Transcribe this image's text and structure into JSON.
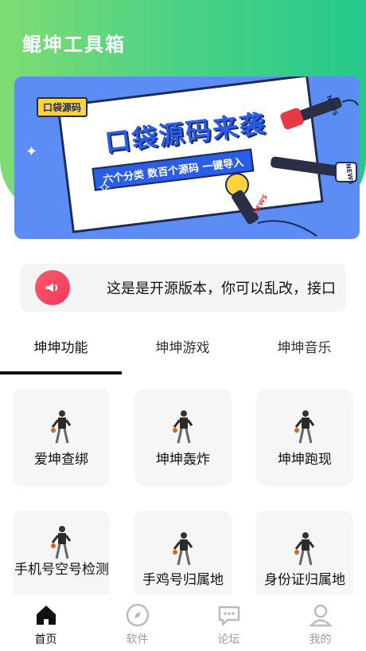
{
  "app": {
    "title": "鲲坤工具箱"
  },
  "banner": {
    "badge": "口袋源码",
    "headline": "口袋源码来袭",
    "subline": "六个分类 数百个源码 一键导入",
    "mic_label": "NEWS"
  },
  "notice": {
    "text": "这是是开源版本，你可以乱改，接口"
  },
  "tabs": [
    {
      "label": "坤坤功能",
      "active": true
    },
    {
      "label": "坤坤游戏",
      "active": false
    },
    {
      "label": "坤坤音乐",
      "active": false
    }
  ],
  "grid": [
    {
      "label": "爱坤查绑"
    },
    {
      "label": "坤坤轰炸"
    },
    {
      "label": "坤坤跑现"
    },
    {
      "label": "手机号空号检测"
    },
    {
      "label": "手鸡号归属地"
    },
    {
      "label": "身份证归属地"
    }
  ],
  "nav": [
    {
      "label": "首页",
      "icon": "home-icon",
      "active": true
    },
    {
      "label": "软件",
      "icon": "compass-icon",
      "active": false
    },
    {
      "label": "论坛",
      "icon": "chat-icon",
      "active": false
    },
    {
      "label": "我的",
      "icon": "user-icon",
      "active": false
    }
  ],
  "colors": {
    "accent_start": "#7fdc73",
    "accent_end": "#25c98c",
    "notice_icon": "#f0365a"
  }
}
